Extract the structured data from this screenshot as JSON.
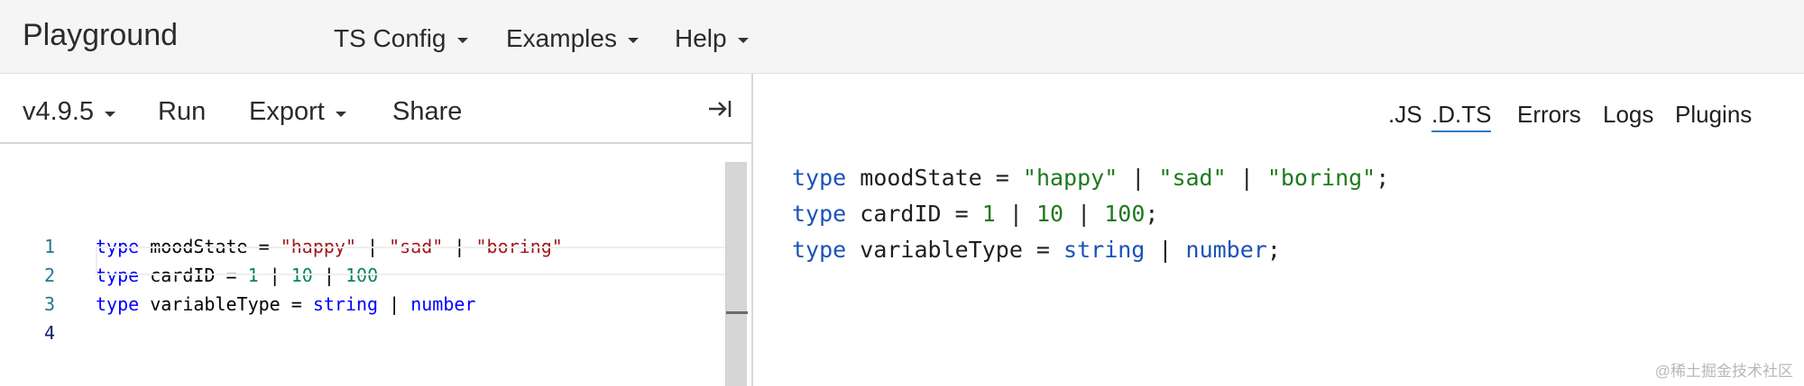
{
  "nav": {
    "brand": "Playground",
    "items": [
      {
        "label": "TS Config"
      },
      {
        "label": "Examples"
      },
      {
        "label": "Help"
      }
    ]
  },
  "toolbar": {
    "version": "v4.9.5",
    "run": "Run",
    "export": "Export",
    "share": "Share"
  },
  "editor": {
    "line_numbers": [
      "1",
      "2",
      "3",
      "4"
    ],
    "lines": [
      [
        {
          "t": "type",
          "c": "kw"
        },
        {
          "t": " moodState = ",
          "c": ""
        },
        {
          "t": "\"happy\"",
          "c": "str"
        },
        {
          "t": " | ",
          "c": ""
        },
        {
          "t": "\"sad\"",
          "c": "str"
        },
        {
          "t": " | ",
          "c": ""
        },
        {
          "t": "\"boring\"",
          "c": "str"
        }
      ],
      [
        {
          "t": "type",
          "c": "kw"
        },
        {
          "t": " cardID = ",
          "c": ""
        },
        {
          "t": "1",
          "c": "num"
        },
        {
          "t": " | ",
          "c": ""
        },
        {
          "t": "10",
          "c": "num"
        },
        {
          "t": " | ",
          "c": ""
        },
        {
          "t": "100",
          "c": "num"
        }
      ],
      [
        {
          "t": "type",
          "c": "kw"
        },
        {
          "t": " variableType = ",
          "c": ""
        },
        {
          "t": "string",
          "c": "ty"
        },
        {
          "t": " | ",
          "c": ""
        },
        {
          "t": "number",
          "c": "ty"
        }
      ],
      []
    ]
  },
  "output": {
    "tabs": [
      {
        "label": ".JS",
        "active": false
      },
      {
        "label": ".D.TS",
        "active": true
      },
      {
        "label": "Errors",
        "active": false
      },
      {
        "label": "Logs",
        "active": false
      },
      {
        "label": "Plugins",
        "active": false
      }
    ],
    "lines": [
      [
        {
          "t": "type",
          "c": "kw"
        },
        {
          "t": " moodState = ",
          "c": ""
        },
        {
          "t": "\"happy\"",
          "c": "str"
        },
        {
          "t": " | ",
          "c": ""
        },
        {
          "t": "\"sad\"",
          "c": "str"
        },
        {
          "t": " | ",
          "c": ""
        },
        {
          "t": "\"boring\"",
          "c": "str"
        },
        {
          "t": ";",
          "c": ""
        }
      ],
      [
        {
          "t": "type",
          "c": "kw"
        },
        {
          "t": " cardID = ",
          "c": ""
        },
        {
          "t": "1",
          "c": "num"
        },
        {
          "t": " | ",
          "c": ""
        },
        {
          "t": "10",
          "c": "num"
        },
        {
          "t": " | ",
          "c": ""
        },
        {
          "t": "100",
          "c": "num"
        },
        {
          "t": ";",
          "c": ""
        }
      ],
      [
        {
          "t": "type",
          "c": "kw"
        },
        {
          "t": " variableType = ",
          "c": ""
        },
        {
          "t": "string",
          "c": "ty"
        },
        {
          "t": " | ",
          "c": ""
        },
        {
          "t": "number",
          "c": "ty"
        },
        {
          "t": ";",
          "c": ""
        }
      ]
    ]
  },
  "watermark": "@稀土掘金技术社区",
  "colors": {
    "keyword": "#0000ff",
    "string_editor": "#a31515",
    "number_editor": "#098658",
    "output_keyword": "#1a52b8",
    "output_literal": "#1e7a1e",
    "tab_underline": "#3178c6"
  }
}
